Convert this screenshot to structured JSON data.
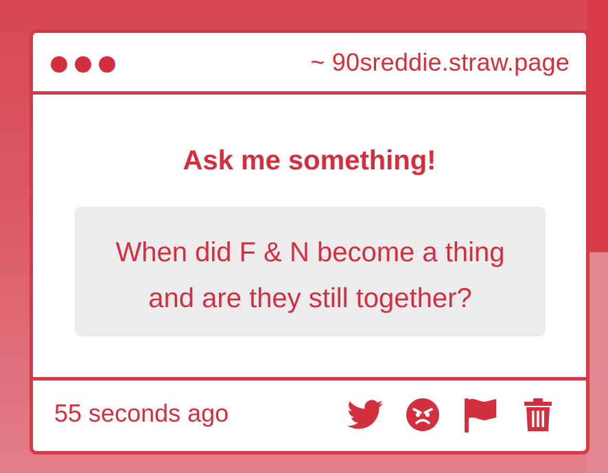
{
  "window": {
    "url": "~ 90sreddie.straw.page"
  },
  "prompt": {
    "title": "Ask me something!"
  },
  "question": {
    "line1": "When did F & N become a thing",
    "line2": "and are they still together?"
  },
  "footer": {
    "timestamp": "55 seconds ago",
    "actions": [
      {
        "icon": "twitter-icon"
      },
      {
        "icon": "angry-face-icon"
      },
      {
        "icon": "flag-icon"
      },
      {
        "icon": "trash-icon"
      }
    ]
  },
  "colors": {
    "accent": "#d2303e",
    "border": "#d43a47",
    "question_bg": "#ecebed",
    "background": "#d84655"
  }
}
